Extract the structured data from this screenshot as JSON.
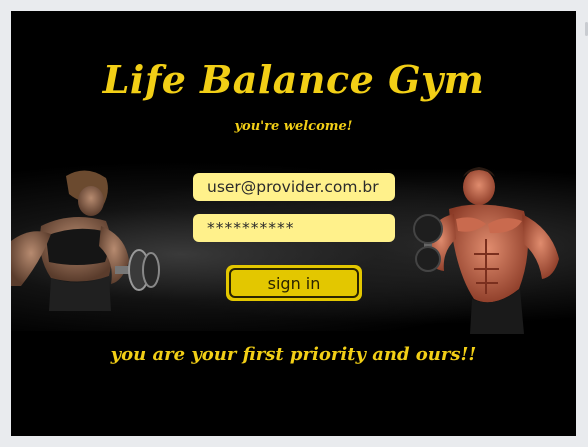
{
  "header": {
    "title": "Life Balance Gym",
    "subtitle": "you're welcome!"
  },
  "login": {
    "email_value": "user@provider.com.br",
    "password_value": "**********",
    "signin_label": "sign in"
  },
  "footer": {
    "tagline": "you are your first priority and ours!!"
  },
  "colors": {
    "accent": "#f2cf16",
    "field_bg": "#fff18b",
    "button_bg": "#e3c700",
    "background": "#000000"
  }
}
